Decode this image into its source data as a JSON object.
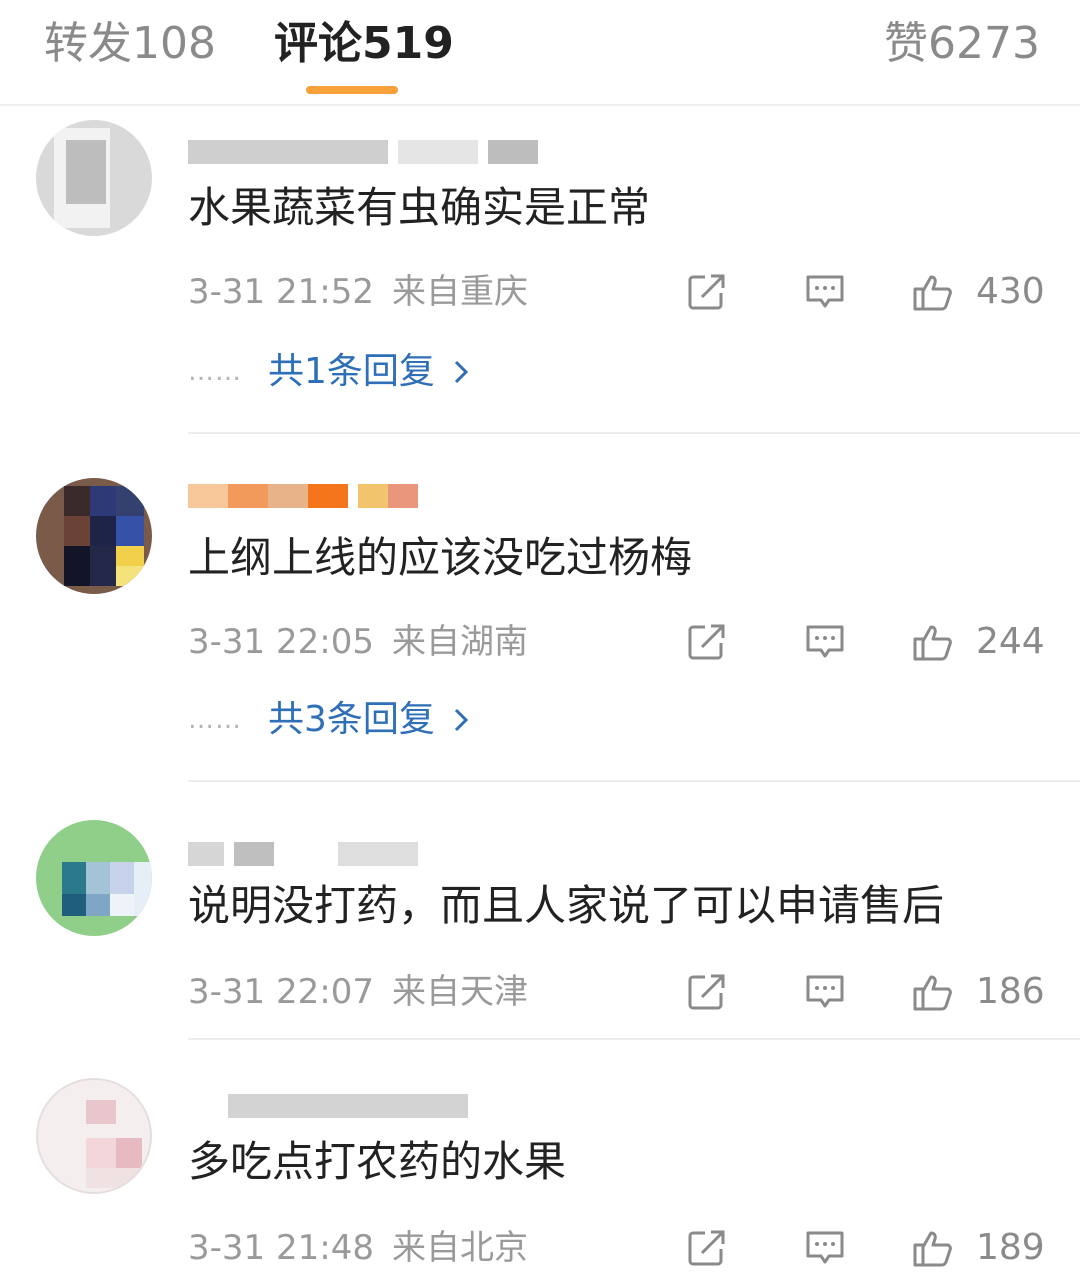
{
  "tabs": {
    "reposts": {
      "label": "转发",
      "count": "108"
    },
    "comments": {
      "label": "评论",
      "count": "519"
    },
    "likes": {
      "label": "赞",
      "count": "6273"
    }
  },
  "colors": {
    "accent": "#f7a13a",
    "link": "#2f6fb7",
    "meta": "#9a9a9a",
    "text": "#222222"
  },
  "comments": [
    {
      "text": "水果蔬菜有虫确实是正常",
      "time": "3-31 21:52",
      "location": "来自重庆",
      "likes": "430",
      "replies": "共1条回复",
      "dots": "……"
    },
    {
      "text": "上纲上线的应该没吃过杨梅",
      "time": "3-31 22:05",
      "location": "来自湖南",
      "likes": "244",
      "replies": "共3条回复",
      "dots": "……"
    },
    {
      "text": "说明没打药，而且人家说了可以申请售后",
      "time": "3-31 22:07",
      "location": "来自天津",
      "likes": "186"
    },
    {
      "text": "多吃点打农药的水果",
      "time": "3-31 21:48",
      "location": "来自北京",
      "likes": "189"
    }
  ],
  "icons": {
    "share": "share-icon",
    "comment": "comment-icon",
    "like": "thumbs-up-icon",
    "chevron": "chevron-right-icon"
  }
}
